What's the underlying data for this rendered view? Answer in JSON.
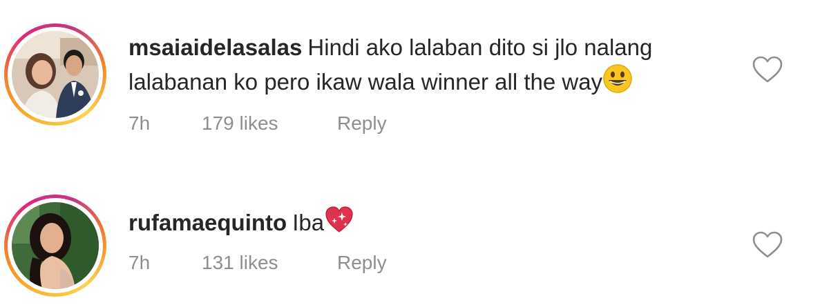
{
  "comments": [
    {
      "username": "msaiaidelasalas",
      "text": "Hindi ako lalaban dito si jlo nalang lalabanan ko pero ikaw wala winner all the way",
      "emoji": "grinning-face",
      "time": "7h",
      "likes": "179 likes",
      "reply": "Reply"
    },
    {
      "username": "rufamaequinto",
      "text": "Iba",
      "emoji": "sparkling-heart",
      "time": "7h",
      "likes": "131 likes",
      "reply": "Reply"
    }
  ],
  "colors": {
    "text": "#262626",
    "secondary": "#8e8e8e",
    "story_ring_start": "#f58529",
    "story_ring_end": "#dd2a7b"
  },
  "icons": {
    "like": "heart-outline-icon"
  }
}
